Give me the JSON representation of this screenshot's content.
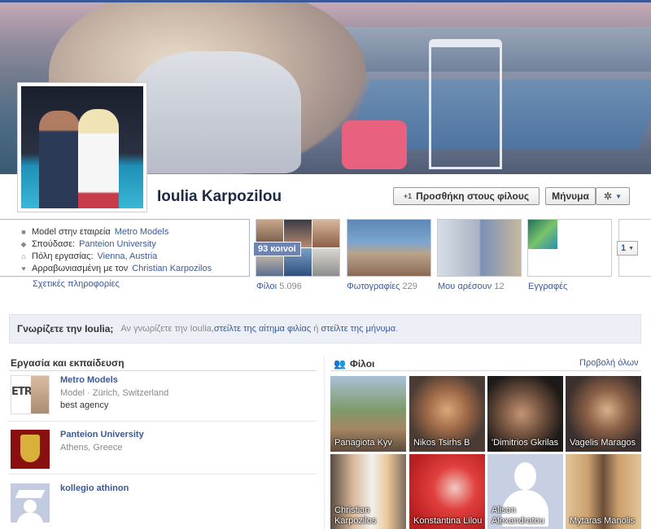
{
  "profile": {
    "name": "Ioulia Karpozilou",
    "add_friend_label": "Προσθήκη στους φίλους",
    "message_label": "Μήνυμα",
    "add_friend_icon": "+1"
  },
  "info": {
    "rows": [
      {
        "icon": "briefcase-icon",
        "text": "Model στην εταιρεία ",
        "link": "Metro Models"
      },
      {
        "icon": "graduation-cap-icon",
        "text": "Σπούδασε: ",
        "link": "Panteion University"
      },
      {
        "icon": "home-icon",
        "text": "Πόλη εργασίας: ",
        "link": "Vienna, Austria"
      },
      {
        "icon": "heart-icon",
        "text": "Αρραβωνιασμένη με τον ",
        "link": "Christian Karpozilos"
      }
    ],
    "about_link": "Σχετικές πληροφορίες"
  },
  "tiles": {
    "friends": {
      "label": "Φίλοι",
      "count": "5.096",
      "mutual_badge": "93 κοινοί"
    },
    "photos": {
      "label": "Φωτογραφίες",
      "count": "229"
    },
    "likes": {
      "label": "Μου αρέσουν",
      "count": "12"
    },
    "notes": {
      "label": "Εγγραφές",
      "count": ""
    },
    "more_value": "1"
  },
  "know": {
    "question": "Γνωρίζετε την Ioulia;",
    "pre": "Αν γνωρίζετε την Ioulia, ",
    "link1": "στείλτε της αίτημα φιλίας",
    "mid": " ή ",
    "link2": "στείλτε της μήνυμα",
    "end": "."
  },
  "work": {
    "title": "Εργασία και εκπαίδευση",
    "items": [
      {
        "name": "Metro Models",
        "sub": "Model · Zürich, Switzerland",
        "sub2": "best agency",
        "logo_text": "ETRO"
      },
      {
        "name": "Panteion University",
        "sub": "Athens, Greece",
        "sub2": ""
      },
      {
        "name": "kollegio athinon",
        "sub": "",
        "sub2": ""
      }
    ]
  },
  "friends": {
    "title": "Φίλοι",
    "see_all": "Προβολή όλων",
    "list": [
      {
        "name": "Panagiota Kyv"
      },
      {
        "name": "Nikos Tsirhs B"
      },
      {
        "name": "'Dimitrios Gkrilas"
      },
      {
        "name": "Vagelis Maragos"
      },
      {
        "name": "Christian Karpozilos"
      },
      {
        "name": "Konstantina Lilou"
      },
      {
        "name": "Alison Alexandratou"
      },
      {
        "name": "Mytaras Manolis"
      }
    ]
  },
  "colors": {
    "brand": "#3b5998",
    "know_bar_bg": "#eceff5",
    "badge_bg": "#6d84b4"
  }
}
